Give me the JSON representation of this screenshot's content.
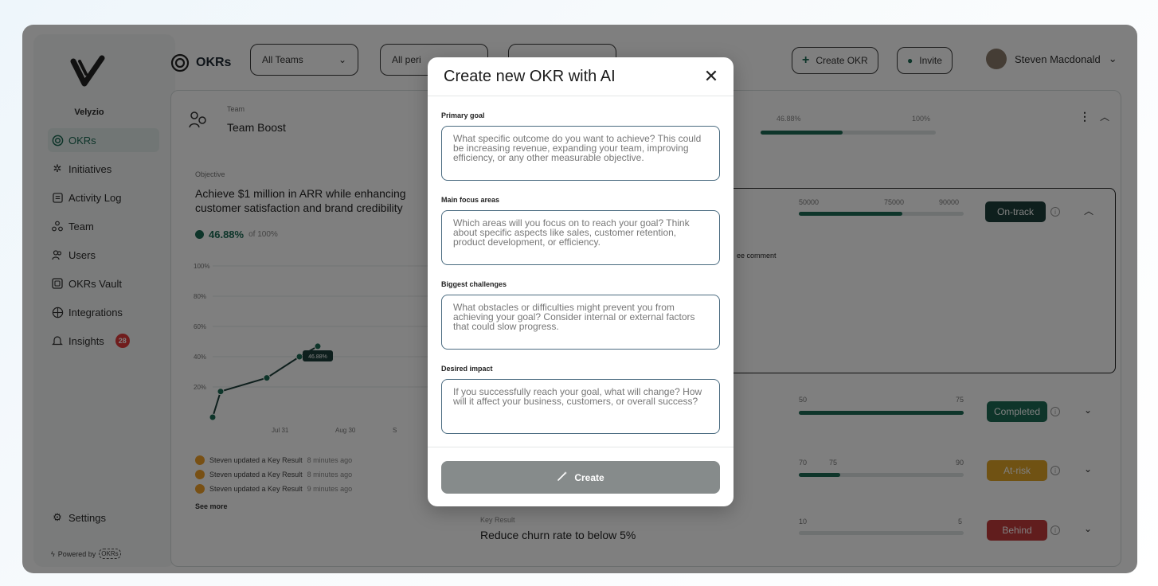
{
  "sidebar": {
    "brand": "Velyzio",
    "items": [
      {
        "label": "OKRs",
        "icon": "okrs-icon"
      },
      {
        "label": "Initiatives",
        "icon": "initiatives-icon"
      },
      {
        "label": "Activity Log",
        "icon": "activity-log-icon"
      },
      {
        "label": "Team",
        "icon": "team-icon"
      },
      {
        "label": "Users",
        "icon": "users-icon"
      },
      {
        "label": "OKRs Vault",
        "icon": "vault-icon"
      },
      {
        "label": "Integrations",
        "icon": "integrations-icon"
      },
      {
        "label": "Insights",
        "icon": "insights-icon",
        "badge": "28"
      }
    ],
    "settings": "Settings",
    "powered_by": "Powered by",
    "powered_logo": "OKRs"
  },
  "topbar": {
    "title": "OKRs",
    "team_filter": "All Teams",
    "period_filter": "All peri",
    "create_okr": "Create OKR",
    "invite": "Invite",
    "user_name": "Steven Macdonald"
  },
  "team_card": {
    "team_label": "Team",
    "team_name": "Team Boost",
    "progress_current": "46.88%",
    "progress_max": "100%",
    "objective_label": "Objective",
    "objective_title": "Achieve $1 million in ARR while enhancing customer satisfaction and brand credibility",
    "objective_pct": "46.88%",
    "objective_of": "of 100%",
    "chart_tooltip": "46.88%",
    "activity": [
      {
        "text": "Steven updated a Key Result",
        "time": "8 minutes ago"
      },
      {
        "text": "Steven updated a Key Result",
        "time": "8 minutes ago"
      },
      {
        "text": "Steven updated a Key Result",
        "time": "9 minutes ago"
      }
    ],
    "see_more": "See more"
  },
  "chart_data": {
    "type": "line",
    "y_ticks": [
      "100%",
      "80%",
      "60%",
      "40%",
      "20%"
    ],
    "x_ticks": [
      "Jul 31",
      "Aug 30",
      "S"
    ],
    "ylim": [
      0,
      100
    ],
    "series": [
      {
        "values": [
          0,
          17,
          26,
          40,
          46.88
        ]
      }
    ]
  },
  "key_results": [
    {
      "nums": [
        "50000",
        "75000",
        "90000"
      ],
      "progress": 0.63,
      "status": "On-track",
      "status_color": "#1d3f3a",
      "comment": "ee comment"
    },
    {
      "nums": [
        "50",
        "75"
      ],
      "progress": 1.0,
      "status": "Completed",
      "status_color": "#1d6b55"
    },
    {
      "nums": [
        "70",
        "75",
        "90"
      ],
      "progress": 0.25,
      "status": "At-risk",
      "status_color": "#e0a526"
    },
    {
      "label": "Key Result",
      "title": "Reduce churn rate to below 5%",
      "nums": [
        "10",
        "5"
      ],
      "progress": 0.0,
      "status": "Behind",
      "status_color": "#c23b3b"
    }
  ],
  "modal": {
    "title": "Create new OKR with AI",
    "fields": [
      {
        "label": "Primary goal",
        "placeholder": "What specific outcome do you want to achieve? This could be increasing revenue, expanding your team, improving efficiency, or any other measurable objective."
      },
      {
        "label": "Main focus areas",
        "placeholder": "Which areas will you focus on to reach your goal? Think about specific aspects like sales, customer retention, product development, or efficiency."
      },
      {
        "label": "Biggest challenges",
        "placeholder": "What obstacles or difficulties might prevent you from achieving your goal? Consider internal or external factors that could slow progress."
      },
      {
        "label": "Desired impact",
        "placeholder": "If you successfully reach your goal, what will change? How will it affect your business, customers, or overall success?"
      }
    ],
    "create_label": "Create"
  }
}
